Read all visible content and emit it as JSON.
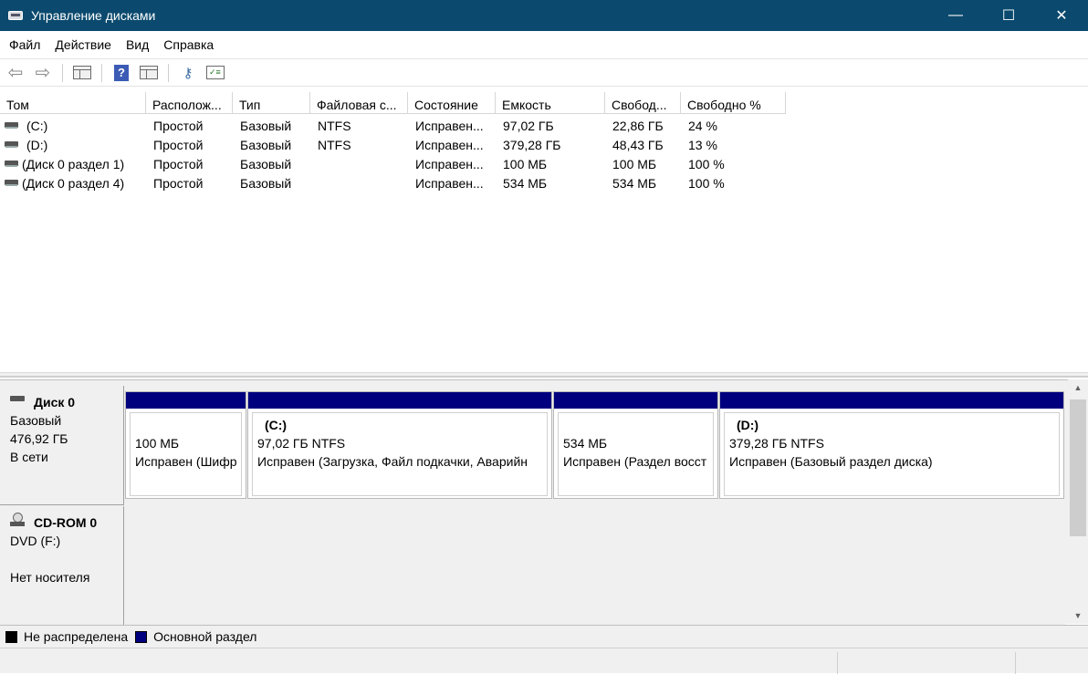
{
  "window": {
    "title": "Управление дисками",
    "minimize": "—",
    "maximize": "☐",
    "close": "✕"
  },
  "menu": [
    "Файл",
    "Действие",
    "Вид",
    "Справка"
  ],
  "toolbar": {
    "icons": [
      "back-arrow-icon",
      "forward-arrow-icon",
      "show-hide-console-tree-icon",
      "help-icon",
      "action-pane-icon",
      "connect-icon",
      "properties-icon"
    ]
  },
  "volume_list": {
    "columns": [
      "Том",
      "Располож...",
      "Тип",
      "Файловая с...",
      "Состояние",
      "Емкость",
      "Свобод...",
      "Свободно %"
    ],
    "rows": [
      [
        "(C:)",
        "Простой",
        "Базовый",
        "NTFS",
        "Исправен...",
        "97,02 ГБ",
        "22,86 ГБ",
        "24 %"
      ],
      [
        "(D:)",
        "Простой",
        "Базовый",
        "NTFS",
        "Исправен...",
        "379,28 ГБ",
        "48,43 ГБ",
        "13 %"
      ],
      [
        "(Диск 0 раздел 1)",
        "Простой",
        "Базовый",
        "",
        "Исправен...",
        "100 МБ",
        "100 МБ",
        "100 %"
      ],
      [
        "(Диск 0 раздел 4)",
        "Простой",
        "Базовый",
        "",
        "Исправен...",
        "534 МБ",
        "534 МБ",
        "100 %"
      ]
    ]
  },
  "disks": [
    {
      "name": "Диск 0",
      "type": "Базовый",
      "size": "476,92 ГБ",
      "status": "В сети",
      "partitions": [
        {
          "name": "",
          "size": "100 МБ",
          "state": "Исправен (Шифр"
        },
        {
          "name": "(C:)",
          "size": "97,02 ГБ NTFS",
          "state": "Исправен (Загрузка, Файл подкачки, Аварийн"
        },
        {
          "name": "",
          "size": "534 МБ",
          "state": "Исправен (Раздел восст"
        },
        {
          "name": "(D:)",
          "size": "379,28 ГБ NTFS",
          "state": "Исправен (Базовый раздел диска)"
        }
      ]
    },
    {
      "name": "CD-ROM 0",
      "type": "DVD (F:)",
      "status": "Нет носителя"
    }
  ],
  "legend": [
    {
      "label": "Не распределена",
      "color": "#000000"
    },
    {
      "label": "Основной раздел",
      "color": "#00007f"
    }
  ],
  "scrollbar": {
    "up": "▲",
    "down": "▼"
  }
}
